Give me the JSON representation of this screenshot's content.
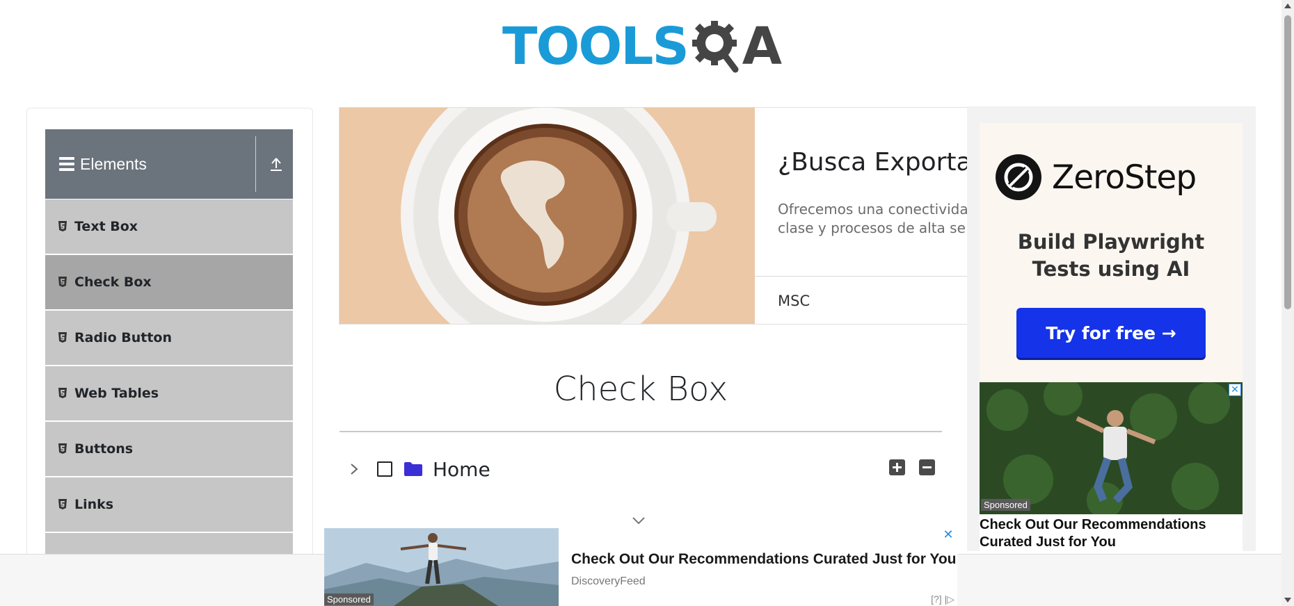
{
  "header": {
    "logo_text": "TOOLS",
    "logo_suffix": "A"
  },
  "sidebar": {
    "group_title": "Elements",
    "items": [
      {
        "label": "Text Box",
        "active": false
      },
      {
        "label": "Check Box",
        "active": true
      },
      {
        "label": "Radio Button",
        "active": false
      },
      {
        "label": "Web Tables",
        "active": false
      },
      {
        "label": "Buttons",
        "active": false
      },
      {
        "label": "Links",
        "active": false
      }
    ]
  },
  "top_ad": {
    "headline": "¿Busca Exportar",
    "description": "Ofrecemos una conectivida\nclase y procesos de alta se",
    "brand": "MSC"
  },
  "main": {
    "title": "Check Box",
    "tree": {
      "root_label": "Home",
      "checked": false,
      "expanded": false
    }
  },
  "right_ad": {
    "brand": "ZeroStep",
    "tagline_line1": "Build Playwright",
    "tagline_line2": "Tests using AI",
    "cta": "Try for free →",
    "rec_sponsored": "Sponsored",
    "rec_title": "Check Out Our Recommendations Curated Just for You"
  },
  "bottom_ad": {
    "sponsored": "Sponsored",
    "title": "Check Out Our Recommendations Curated Just for You",
    "source": "DiscoveryFeed",
    "adchoice": "[?]"
  },
  "colors": {
    "logo_blue": "#1a9bd7",
    "sidebar_header": "#6b737c",
    "menu_item": "#c6c6c6",
    "menu_item_active": "#a6a6a6",
    "cta_blue": "#1533e8",
    "folder": "#3b2fd6"
  }
}
